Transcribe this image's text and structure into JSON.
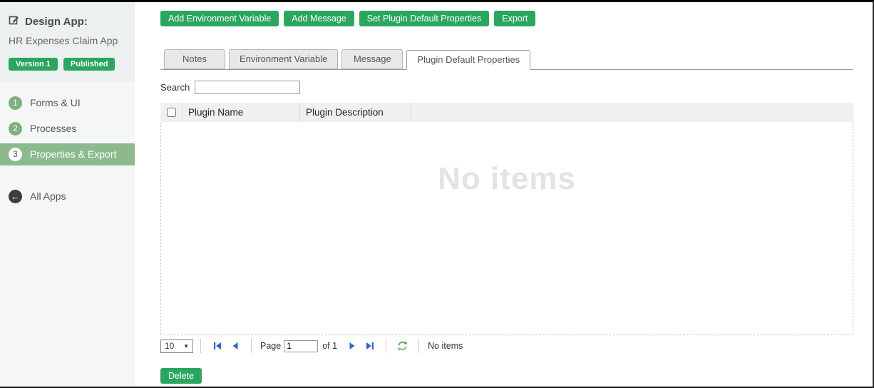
{
  "colors": {
    "accent_green": "#2aa65f",
    "selected_menu_green": "#8cba8d",
    "menu_circle_green": "#7fb080",
    "pager_arrow_blue": "#3366cc",
    "refresh_green": "#58a958",
    "sidebar_bg": "#f5f7f7",
    "watermark_gray": "#e3e3e3"
  },
  "sidebar": {
    "title": "Design App:",
    "app_name": "HR Expenses Claim App",
    "badges": [
      "Version 1",
      "Published"
    ],
    "menu": [
      {
        "num": "1",
        "label": "Forms & UI"
      },
      {
        "num": "2",
        "label": "Processes"
      },
      {
        "num": "3",
        "label": "Properties & Export"
      }
    ],
    "back_label": "All Apps"
  },
  "toolbar": {
    "buttons": [
      "Add Environment Variable",
      "Add Message",
      "Set Plugin Default Properties",
      "Export"
    ]
  },
  "tabs": [
    {
      "label": "Notes"
    },
    {
      "label": "Environment Variable"
    },
    {
      "label": "Message"
    },
    {
      "label": "Plugin Default Properties"
    }
  ],
  "search": {
    "label": "Search",
    "value": ""
  },
  "table": {
    "columns": [
      "Plugin Name",
      "Plugin Description"
    ],
    "empty_text": "No items"
  },
  "pagination": {
    "page_size": "10",
    "page_label": "Page",
    "page_value": "1",
    "of_text": "of 1",
    "status": "No items"
  },
  "footer": {
    "delete_label": "Delete"
  },
  "icons": {
    "dropdown_arrow": "▼",
    "back_arrow": "←"
  }
}
